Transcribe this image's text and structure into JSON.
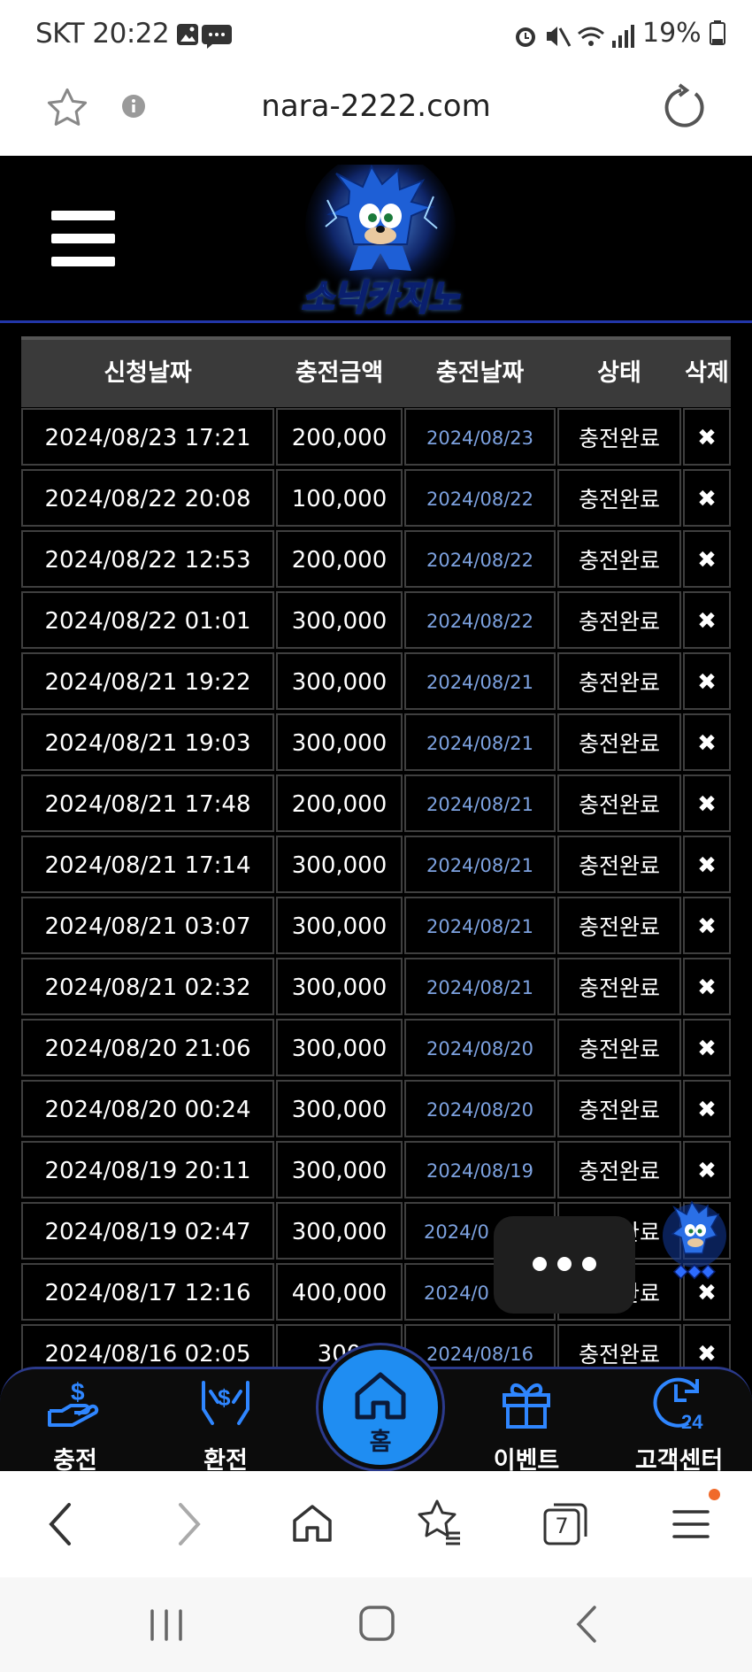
{
  "status_bar": {
    "carrier_time": "SKT 20:22",
    "battery": "19%"
  },
  "browser": {
    "url": "nara-2222.com",
    "tab_count": "7"
  },
  "site": {
    "logo_text": "소닉카지노",
    "accent_color": "#1f8df2"
  },
  "table": {
    "headers": [
      "신청날짜",
      "충전금액",
      "충전날짜",
      "상태",
      "삭제"
    ],
    "rows": [
      {
        "requested": "2024/08/23 17:21",
        "amount": "200,000",
        "charged": "2024/08/23",
        "status": "충전완료",
        "delete": "✖"
      },
      {
        "requested": "2024/08/22 20:08",
        "amount": "100,000",
        "charged": "2024/08/22",
        "status": "충전완료",
        "delete": "✖"
      },
      {
        "requested": "2024/08/22 12:53",
        "amount": "200,000",
        "charged": "2024/08/22",
        "status": "충전완료",
        "delete": "✖"
      },
      {
        "requested": "2024/08/22 01:01",
        "amount": "300,000",
        "charged": "2024/08/22",
        "status": "충전완료",
        "delete": "✖"
      },
      {
        "requested": "2024/08/21 19:22",
        "amount": "300,000",
        "charged": "2024/08/21",
        "status": "충전완료",
        "delete": "✖"
      },
      {
        "requested": "2024/08/21 19:03",
        "amount": "300,000",
        "charged": "2024/08/21",
        "status": "충전완료",
        "delete": "✖"
      },
      {
        "requested": "2024/08/21 17:48",
        "amount": "200,000",
        "charged": "2024/08/21",
        "status": "충전완료",
        "delete": "✖"
      },
      {
        "requested": "2024/08/21 17:14",
        "amount": "300,000",
        "charged": "2024/08/21",
        "status": "충전완료",
        "delete": "✖"
      },
      {
        "requested": "2024/08/21 03:07",
        "amount": "300,000",
        "charged": "2024/08/21",
        "status": "충전완료",
        "delete": "✖"
      },
      {
        "requested": "2024/08/21 02:32",
        "amount": "300,000",
        "charged": "2024/08/21",
        "status": "충전완료",
        "delete": "✖"
      },
      {
        "requested": "2024/08/20 21:06",
        "amount": "300,000",
        "charged": "2024/08/20",
        "status": "충전완료",
        "delete": "✖"
      },
      {
        "requested": "2024/08/20 00:24",
        "amount": "300,000",
        "charged": "2024/08/20",
        "status": "충전완료",
        "delete": "✖"
      },
      {
        "requested": "2024/08/19 20:11",
        "amount": "300,000",
        "charged": "2024/08/19",
        "status": "충전완료",
        "delete": "✖"
      },
      {
        "requested": "2024/08/19 02:47",
        "amount": "300,000",
        "charged": "2024/0",
        "status": "완료",
        "delete": ""
      },
      {
        "requested": "2024/08/17 12:16",
        "amount": "400,000",
        "charged": "2024/0",
        "status": "완료",
        "delete": "✖"
      },
      {
        "requested": "2024/08/16 02:05",
        "amount": "300",
        "charged": "2024/08/16",
        "status": "충전완료",
        "delete": "✖"
      }
    ]
  },
  "site_nav": {
    "items": [
      {
        "label": "충전",
        "icon": "hand-money-icon"
      },
      {
        "label": "환전",
        "icon": "money-exchange-icon"
      },
      {
        "label": "홈",
        "icon": "home-icon"
      },
      {
        "label": "이벤트",
        "icon": "gift-icon"
      },
      {
        "label": "고객센터",
        "icon": "support-24-icon"
      }
    ]
  }
}
